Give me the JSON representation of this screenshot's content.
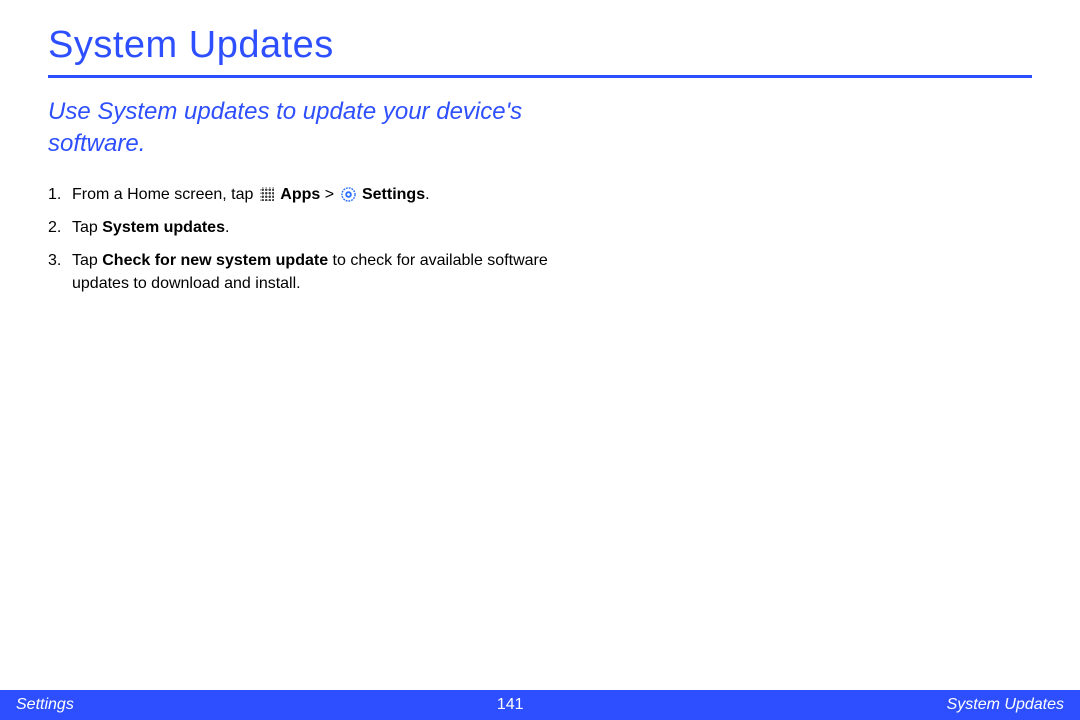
{
  "page": {
    "title": "System Updates",
    "subtitle": "Use System updates to update your device's software."
  },
  "steps": {
    "s1": {
      "p1": "From a Home screen, tap ",
      "apps": "Apps",
      "sep": " > ",
      "settings": "Settings",
      "end": "."
    },
    "s2": {
      "p1": "Tap ",
      "b1": "System updates",
      "end": "."
    },
    "s3": {
      "p1": "Tap ",
      "b1": "Check for new system update",
      "p2": " to check for available software updates to download and install."
    }
  },
  "footer": {
    "left": "Settings",
    "pagenum": "141",
    "right": "System Updates"
  }
}
